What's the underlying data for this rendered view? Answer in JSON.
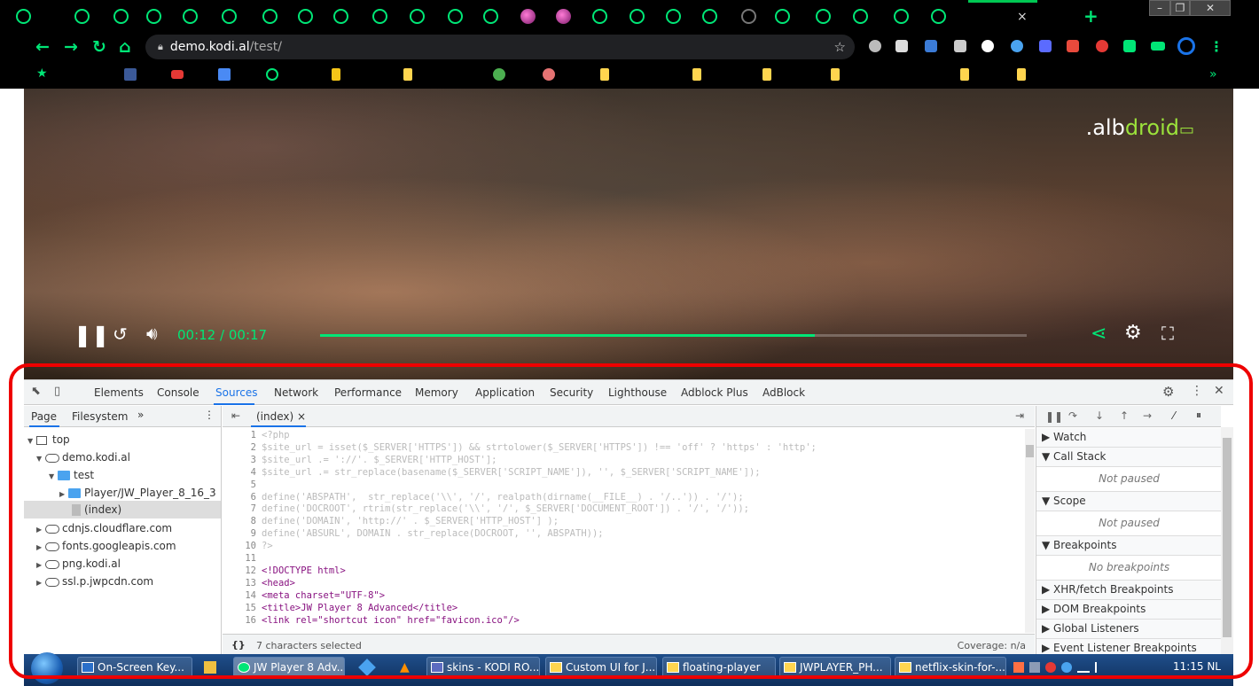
{
  "browser": {
    "url_host": "demo.kodi.al",
    "url_path": "/test/",
    "tab_close": "×",
    "new_tab": "+",
    "window_controls": [
      "–",
      "❐",
      "✕"
    ],
    "bookmarks_overflow": "»"
  },
  "video": {
    "logo_prefix": ".alb",
    "logo_accent": "droid",
    "current_time": "00:12",
    "time_separator": "/",
    "duration": "00:17",
    "progress_fraction": 0.7,
    "accent_color": "#00e676"
  },
  "devtools": {
    "tabs": [
      "Elements",
      "Console",
      "Sources",
      "Network",
      "Performance",
      "Memory",
      "Application",
      "Security",
      "Lighthouse",
      "Adblock Plus",
      "AdBlock"
    ],
    "active_tab": "Sources",
    "navigator": {
      "tabs": [
        "Page",
        "Filesystem"
      ],
      "more": "»",
      "tree": [
        {
          "label": "top"
        },
        {
          "label": "demo.kodi.al"
        },
        {
          "label": "test"
        },
        {
          "label": "Player/JW_Player_8_16_3"
        },
        {
          "label": "(index)"
        },
        {
          "label": "cdnjs.cloudflare.com"
        },
        {
          "label": "fonts.googleapis.com"
        },
        {
          "label": "png.kodi.al"
        },
        {
          "label": "ssl.p.jwpcdn.com"
        }
      ]
    },
    "editor": {
      "file_tab": "(index)",
      "close": "×",
      "lines": [
        {
          "n": "1",
          "text": "<?php"
        },
        {
          "n": "2",
          "text": "$site_url = isset($_SERVER['HTTPS']) && strtolower($_SERVER['HTTPS']) !== 'off' ? 'https' : 'http';"
        },
        {
          "n": "3",
          "text": "$site_url .= '://'. $_SERVER['HTTP_HOST'];"
        },
        {
          "n": "4",
          "text": "$site_url .= str_replace(basename($_SERVER['SCRIPT_NAME']), '', $_SERVER['SCRIPT_NAME']);"
        },
        {
          "n": "5",
          "text": ""
        },
        {
          "n": "6",
          "text": "define('ABSPATH',  str_replace('\\\\', '/', realpath(dirname(__FILE__) . '/..')) . '/');"
        },
        {
          "n": "7",
          "text": "define('DOCROOT', rtrim(str_replace('\\\\', '/', $_SERVER['DOCUMENT_ROOT']) . '/', '/'));"
        },
        {
          "n": "8",
          "text": "define('DOMAIN', 'http://' . $_SERVER['HTTP_HOST'] );"
        },
        {
          "n": "9",
          "text": "define('ABSURL', DOMAIN . str_replace(DOCROOT, '', ABSPATH));"
        },
        {
          "n": "10",
          "text": "?>"
        },
        {
          "n": "11",
          "text": ""
        },
        {
          "n": "12",
          "text": "<!DOCTYPE html>"
        },
        {
          "n": "13",
          "text": "<head>"
        },
        {
          "n": "14",
          "text": "<meta charset=\"UTF-8\">"
        },
        {
          "n": "15",
          "text": "<title>JW Player 8 Advanced</title>"
        },
        {
          "n": "16",
          "text": "<link rel=\"shortcut icon\" href=\"favicon.ico\"/>"
        }
      ],
      "status_braces": "{}",
      "status": "7 characters selected",
      "coverage": "Coverage: n/a"
    },
    "debugger": {
      "sections": [
        {
          "label": "Watch",
          "expanded": false
        },
        {
          "label": "Call Stack",
          "expanded": true,
          "empty": "Not paused"
        },
        {
          "label": "Scope",
          "expanded": true,
          "empty": "Not paused"
        },
        {
          "label": "Breakpoints",
          "expanded": true,
          "empty": "No breakpoints"
        },
        {
          "label": "XHR/fetch Breakpoints",
          "expanded": false
        },
        {
          "label": "DOM Breakpoints",
          "expanded": false
        },
        {
          "label": "Global Listeners",
          "expanded": false
        },
        {
          "label": "Event Listener Breakpoints",
          "expanded": false
        }
      ]
    }
  },
  "taskbar": {
    "items": [
      "On-Screen Key...",
      "JW Player 8 Adv...",
      "skins - KODI RO...",
      "Custom UI for J...",
      "floating-player",
      "JWPLAYER_PH...",
      "netflix-skin-for-..."
    ],
    "clock": "11:15 NL"
  }
}
